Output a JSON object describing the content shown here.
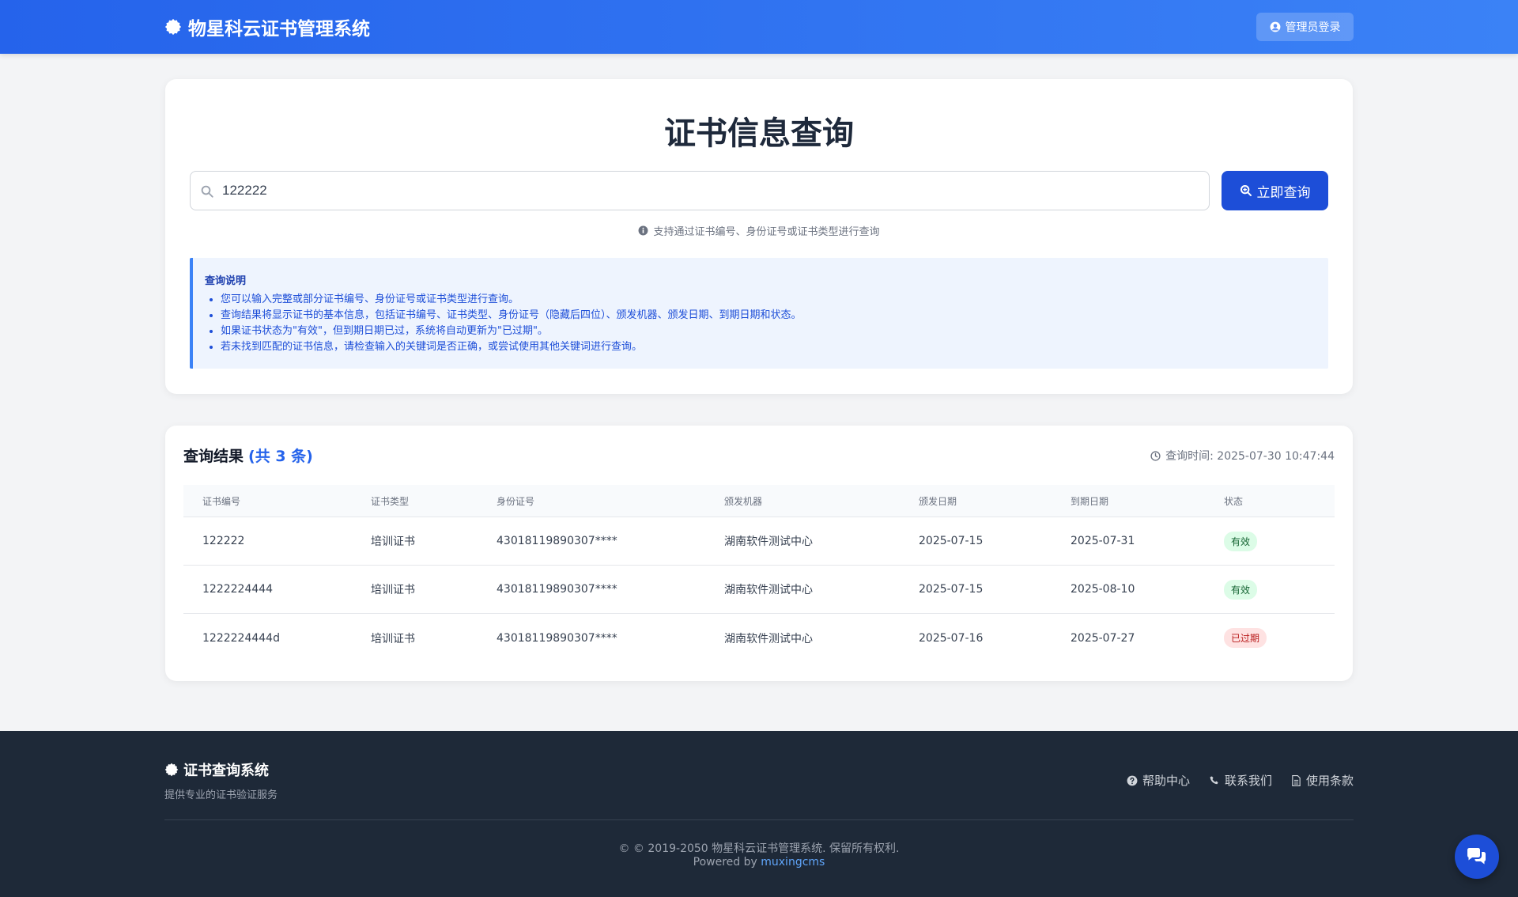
{
  "header": {
    "title": "物星科云证书管理系统",
    "login_label": "管理员登录"
  },
  "search": {
    "page_title": "证书信息查询",
    "query_value": "122222",
    "query_button": "立即查询",
    "hint": "支持通过证书编号、身份证号或证书类型进行查询"
  },
  "notice": {
    "title": "查询说明",
    "items": [
      "您可以输入完整或部分证书编号、身份证号或证书类型进行查询。",
      "查询结果将显示证书的基本信息，包括证书编号、证书类型、身份证号（隐藏后四位）、颁发机器、颁发日期、到期日期和状态。",
      "如果证书状态为\"有效\"，但到期日期已过，系统将自动更新为\"已过期\"。",
      "若未找到匹配的证书信息，请检查输入的关键词是否正确，或尝试使用其他关键词进行查询。"
    ]
  },
  "results": {
    "title": "查询结果",
    "count": "(共 3 条)",
    "query_time": "查询时间: 2025-07-30 10:47:44",
    "columns": [
      "证书编号",
      "证书类型",
      "身份证号",
      "颁发机器",
      "颁发日期",
      "到期日期",
      "状态"
    ],
    "rows": [
      {
        "cert_no": "122222",
        "type": "培训证书",
        "id_no": "43018119890307****",
        "issuer": "湖南软件测试中心",
        "issue_date": "2025-07-15",
        "expire_date": "2025-07-31",
        "status": "有效",
        "status_kind": "valid"
      },
      {
        "cert_no": "1222224444",
        "type": "培训证书",
        "id_no": "43018119890307****",
        "issuer": "湖南软件测试中心",
        "issue_date": "2025-07-15",
        "expire_date": "2025-08-10",
        "status": "有效",
        "status_kind": "valid"
      },
      {
        "cert_no": "1222224444d",
        "type": "培训证书",
        "id_no": "43018119890307****",
        "issuer": "湖南软件测试中心",
        "issue_date": "2025-07-16",
        "expire_date": "2025-07-27",
        "status": "已过期",
        "status_kind": "expired"
      }
    ]
  },
  "footer": {
    "brand": "证书查询系统",
    "tagline": "提供专业的证书验证服务",
    "links": {
      "help": "帮助中心",
      "contact": "联系我们",
      "terms": "使用条款"
    },
    "copyright": "© © 2019-2050 物星科云证书管理系统. 保留所有权利.",
    "powered_prefix": "Powered by",
    "powered_link": "muxingcms"
  },
  "icons": {
    "brand": "certificate-icon",
    "login": "user-circle-icon",
    "search": "search-icon",
    "query": "search-plus-icon",
    "hint": "info-circle-icon",
    "time": "clock-icon",
    "help": "question-circle-icon",
    "contact": "phone-icon",
    "terms": "file-icon",
    "chat": "chat-bubbles-icon"
  },
  "colors": {
    "primary": "#2563eb",
    "valid_bg": "#dcfce7",
    "valid_text": "#166534",
    "expired_bg": "#fee2e2",
    "expired_text": "#b91c1c",
    "footer_bg": "#1e2938"
  }
}
